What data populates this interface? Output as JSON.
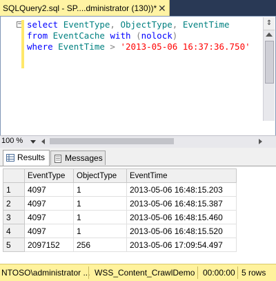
{
  "window": {
    "tab_title": "SQLQuery2.sql - SP....dministrator (130))*",
    "close_glyph": "✕"
  },
  "editor": {
    "collapse_glyph": "−",
    "lines": [
      [
        {
          "t": "kw",
          "v": "select "
        },
        {
          "t": "id",
          "v": "EventType"
        },
        {
          "t": "op",
          "v": ", "
        },
        {
          "t": "id",
          "v": "ObjectType"
        },
        {
          "t": "op",
          "v": ", "
        },
        {
          "t": "id",
          "v": "EventTime"
        }
      ],
      [
        {
          "t": "kw",
          "v": "from "
        },
        {
          "t": "id",
          "v": "EventCache "
        },
        {
          "t": "kw",
          "v": "with "
        },
        {
          "t": "op",
          "v": "("
        },
        {
          "t": "kw",
          "v": "nolock"
        },
        {
          "t": "op",
          "v": ")"
        }
      ],
      [
        {
          "t": "kw",
          "v": "where "
        },
        {
          "t": "id",
          "v": "EventTime "
        },
        {
          "t": "op",
          "v": "> "
        },
        {
          "t": "str",
          "v": "'2013-05-06 16:37:36.750'"
        }
      ]
    ],
    "zoom": "100 %",
    "split_glyph": "⇕"
  },
  "results": {
    "tabs": [
      {
        "label": "Results",
        "icon": "grid-icon",
        "active": true
      },
      {
        "label": "Messages",
        "icon": "messages-icon",
        "active": false
      }
    ],
    "columns": [
      "EventType",
      "ObjectType",
      "EventTime"
    ],
    "rows": [
      [
        "1",
        "4097",
        "1",
        "2013-05-06 16:48:15.203"
      ],
      [
        "2",
        "4097",
        "1",
        "2013-05-06 16:48:15.387"
      ],
      [
        "3",
        "4097",
        "1",
        "2013-05-06 16:48:15.460"
      ],
      [
        "4",
        "4097",
        "1",
        "2013-05-06 16:48:15.520"
      ],
      [
        "5",
        "2097152",
        "256",
        "2013-05-06 17:09:54.497"
      ]
    ]
  },
  "status": {
    "login": "NTOSO\\administrator ...",
    "database": "WSS_Content_CrawlDemo",
    "elapsed": "00:00:00",
    "rows": "5 rows"
  },
  "colors": {
    "tab_active": "#fff3a3",
    "status_bar": "#fff29d",
    "frame": "#293955"
  }
}
